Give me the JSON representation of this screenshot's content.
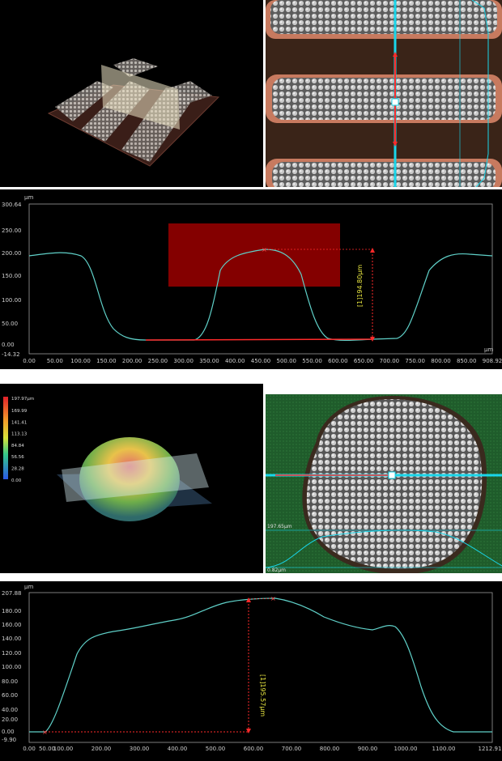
{
  "colors": {
    "curve": "#5fd0c8",
    "measure": "#ff2a2a",
    "highlight": "#8b0000",
    "cyan": "#19d6ea",
    "label": "#e8e640",
    "axis": "#9a9a9a"
  },
  "icons": [
    "cursor-x-icon"
  ],
  "panel1": {
    "cursor_value": "194.80",
    "profile": {
      "unit_label": "μm",
      "y_ticks": [
        "300.64",
        "250.00",
        "200.00",
        "150.00",
        "100.00",
        "50.00",
        "0.00",
        "-14.32"
      ],
      "x_ticks": [
        "0.00",
        "50.00",
        "100.00",
        "150.00",
        "200.00",
        "250.00",
        "300.00",
        "350.00",
        "400.00",
        "450.00",
        "500.00",
        "550.00",
        "600.00",
        "650.00",
        "700.00",
        "750.00",
        "800.00",
        "850.00",
        "908.92"
      ],
      "x_unit": "μm",
      "measure_label": "[1]194.80μm"
    }
  },
  "panel2": {
    "legend": {
      "top": "197.97μm",
      "values": [
        "169.99",
        "141.41",
        "113.13",
        "84.84",
        "56.56",
        "28.28",
        "0.00"
      ]
    },
    "mini_profile": {
      "top_label": "197.65μm",
      "bottom_label": "0.82μm"
    },
    "profile": {
      "unit_label": "μm",
      "y_ticks": [
        "207.88",
        "180.00",
        "160.00",
        "140.00",
        "120.00",
        "100.00",
        "80.00",
        "60.00",
        "40.00",
        "20.00",
        "0.00",
        "-9.90"
      ],
      "x_ticks": [
        "0.00",
        "50.00",
        "100.00",
        "200.00",
        "300.00",
        "400.00",
        "500.00",
        "600.00",
        "700.00",
        "800.00",
        "900.00",
        "1000.00",
        "1100.00",
        "1212.91"
      ],
      "measure_label": "[1]195.57μm"
    }
  }
}
